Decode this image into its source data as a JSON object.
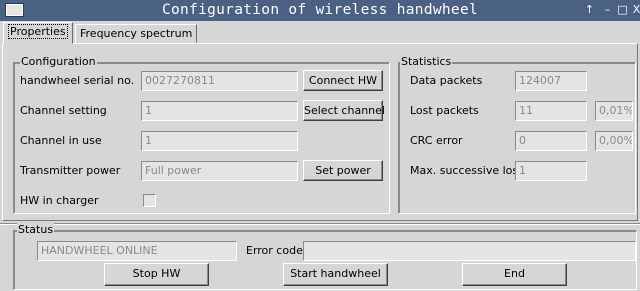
{
  "window": {
    "title": "Configuration of wireless handwheel",
    "controls": {
      "up": "↑",
      "minimize": "–",
      "maximize": "□",
      "close": "X"
    }
  },
  "tabs": [
    {
      "label": "Properties",
      "active": true
    },
    {
      "label": "Frequency spectrum",
      "active": false
    }
  ],
  "configuration": {
    "legend": "Configuration",
    "serial": {
      "label": "handwheel serial no.",
      "value": "0027270811",
      "button": "Connect HW"
    },
    "channel_setting": {
      "label": "Channel setting",
      "value": "1",
      "button": "Select channel"
    },
    "channel_in_use": {
      "label": "Channel in use",
      "value": "1"
    },
    "transmitter_power": {
      "label": "Transmitter power",
      "value": "Full power",
      "button": "Set power"
    },
    "hw_in_charger": {
      "label": "HW in charger",
      "checked": false
    }
  },
  "statistics": {
    "legend": "Statistics",
    "data_packets": {
      "label": "Data packets",
      "value": "124007"
    },
    "lost_packets": {
      "label": "Lost packets",
      "value": "11",
      "percent": "0,01%"
    },
    "crc_error": {
      "label": "CRC error",
      "value": "0",
      "percent": "0,00%"
    },
    "max_successive_lost": {
      "label": "Max. successive lost",
      "value": "1"
    }
  },
  "status": {
    "legend": "Status",
    "state_value": "HANDWHEEL ONLINE",
    "error_code_label": "Error code",
    "error_code_value": ""
  },
  "buttons": {
    "stop_hw": "Stop HW",
    "start_handwheel": "Start handwheel",
    "end": "End"
  }
}
